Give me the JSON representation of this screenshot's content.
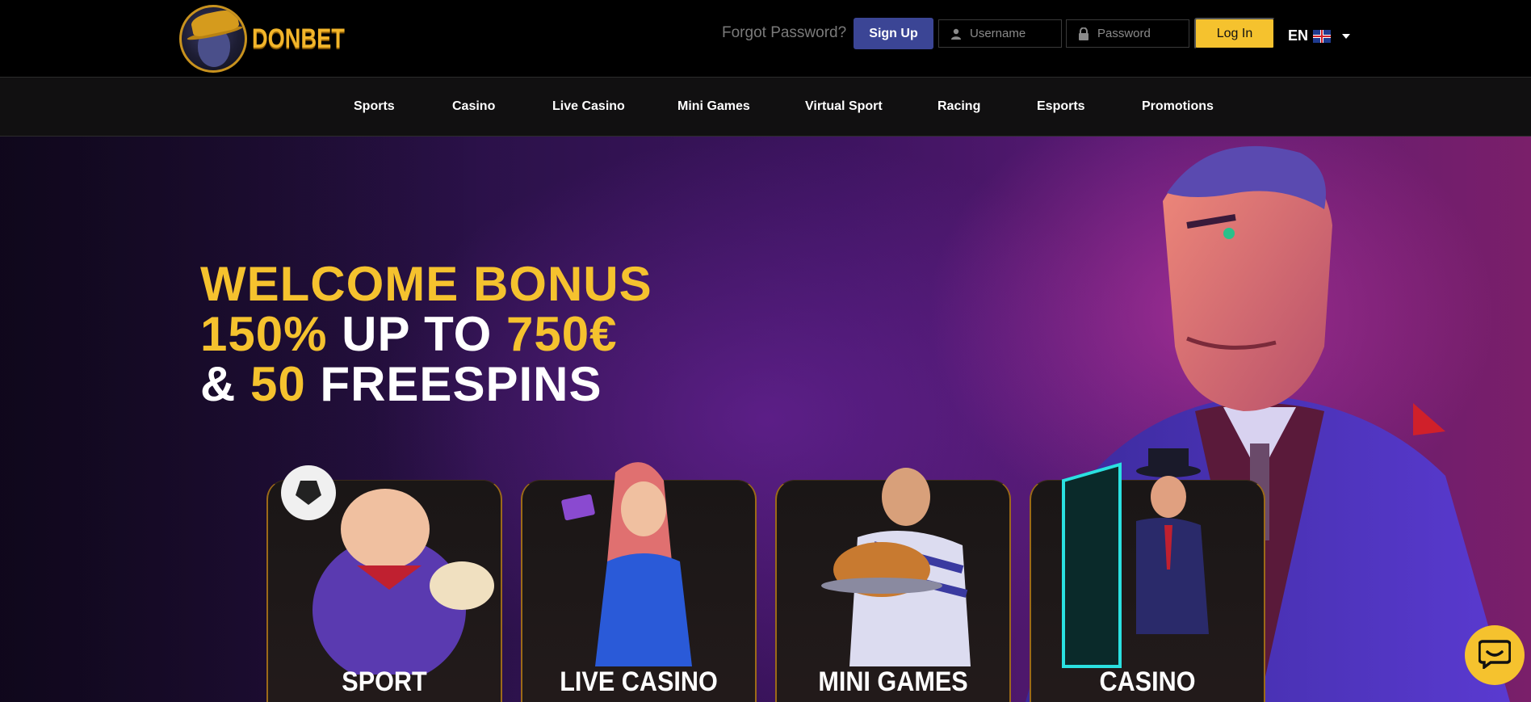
{
  "header": {
    "logo_text": "DONBET",
    "forgot_password": "Forgot Password?",
    "signup_label": "Sign Up",
    "username_placeholder": "Username",
    "password_placeholder": "Password",
    "login_label": "Log In",
    "language": "EN"
  },
  "nav": {
    "items": [
      {
        "label": "Sports"
      },
      {
        "label": "Casino"
      },
      {
        "label": "Live Casino"
      },
      {
        "label": "Mini Games"
      },
      {
        "label": "Virtual Sport"
      },
      {
        "label": "Racing"
      },
      {
        "label": "Esports"
      },
      {
        "label": "Promotions"
      }
    ]
  },
  "hero": {
    "line1": "WELCOME BONUS",
    "line2_a": "150%",
    "line2_b": " UP TO ",
    "line2_c": "750€",
    "line3_a": "& ",
    "line3_b": "50",
    "line3_c": " FREESPINS"
  },
  "cards": [
    {
      "label": "SPORT"
    },
    {
      "label": "LIVE CASINO"
    },
    {
      "label": "MINI GAMES"
    },
    {
      "label": "CASINO"
    }
  ],
  "colors": {
    "accent_yellow": "#f5c22e",
    "signup_blue": "#3b4595",
    "nav_bg": "#111011"
  },
  "icons": {
    "user": "user-icon",
    "lock": "lock-icon",
    "chat": "chat-icon",
    "flag": "uk-flag-icon"
  }
}
